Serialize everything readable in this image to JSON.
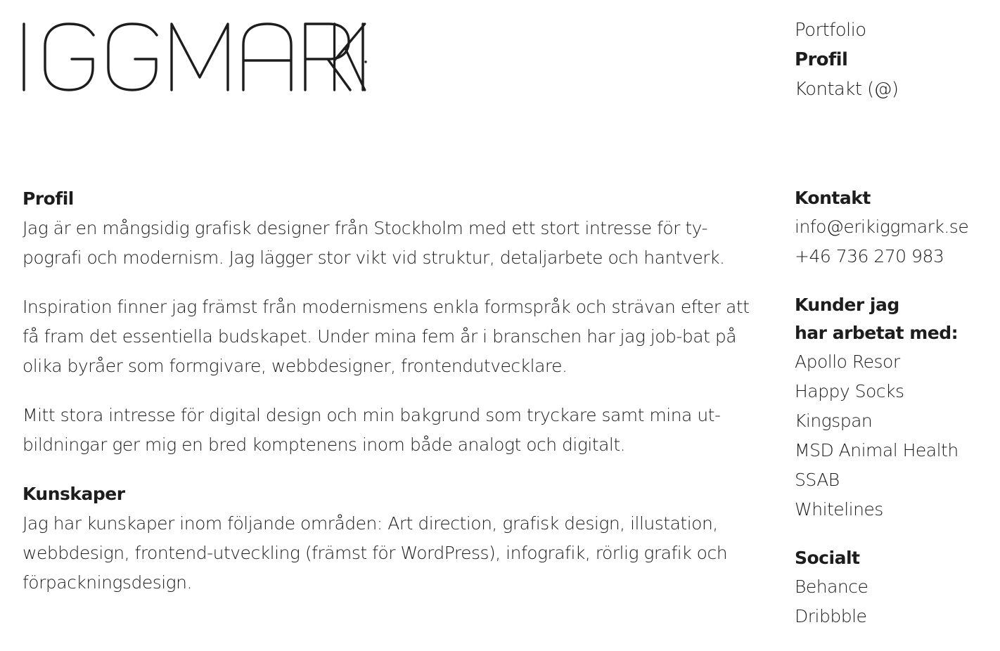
{
  "header": {
    "logo_text": "IGGMARK"
  },
  "nav": {
    "items": [
      {
        "label": "Portfolio",
        "active": false
      },
      {
        "label": "Profil",
        "active": true
      },
      {
        "label": "Kontakt (@)",
        "active": false
      }
    ]
  },
  "main": {
    "profile_heading": "Profil",
    "paragraphs": [
      "Jag är en mångsidig grafisk designer från Stockholm med ett stort intresse för ty-pografi och modernism. Jag lägger stor vikt vid struktur, detaljarbete och hantverk.",
      "Inspiration finner jag främst från modernismens enkla formspråk och strävan efter att få fram det essentiella budskapet. Under mina fem år i branschen har jag job-bat på olika byråer som formgivare, webbdesigner, frontendutvecklare.",
      "Mitt stora intresse för digital design och min bakgrund som tryckare samt mina ut-bildningar ger mig en bred komptenens inom både analogt och digitalt."
    ],
    "skills_heading": "Kunskaper",
    "skills_text": "Jag har kunskaper inom följande områden: Art direction, grafisk design, illustation, webbdesign, frontend-utveckling (främst för WordPress), infografik, rörlig grafik och förpackningsdesign."
  },
  "sidebar": {
    "contact": {
      "heading": "Kontakt",
      "email": "info@erikiggmark.se",
      "phone": "+46 736 270 983"
    },
    "clients": {
      "heading_line1": "Kunder jag",
      "heading_line2": "har arbetat med:",
      "items": [
        "Apollo Resor",
        "Happy Socks",
        "Kingspan",
        "MSD Animal Health",
        "SSAB",
        "Whitelines"
      ]
    },
    "social": {
      "heading": "Socialt",
      "items": [
        "Behance",
        "Dribbble"
      ]
    }
  }
}
